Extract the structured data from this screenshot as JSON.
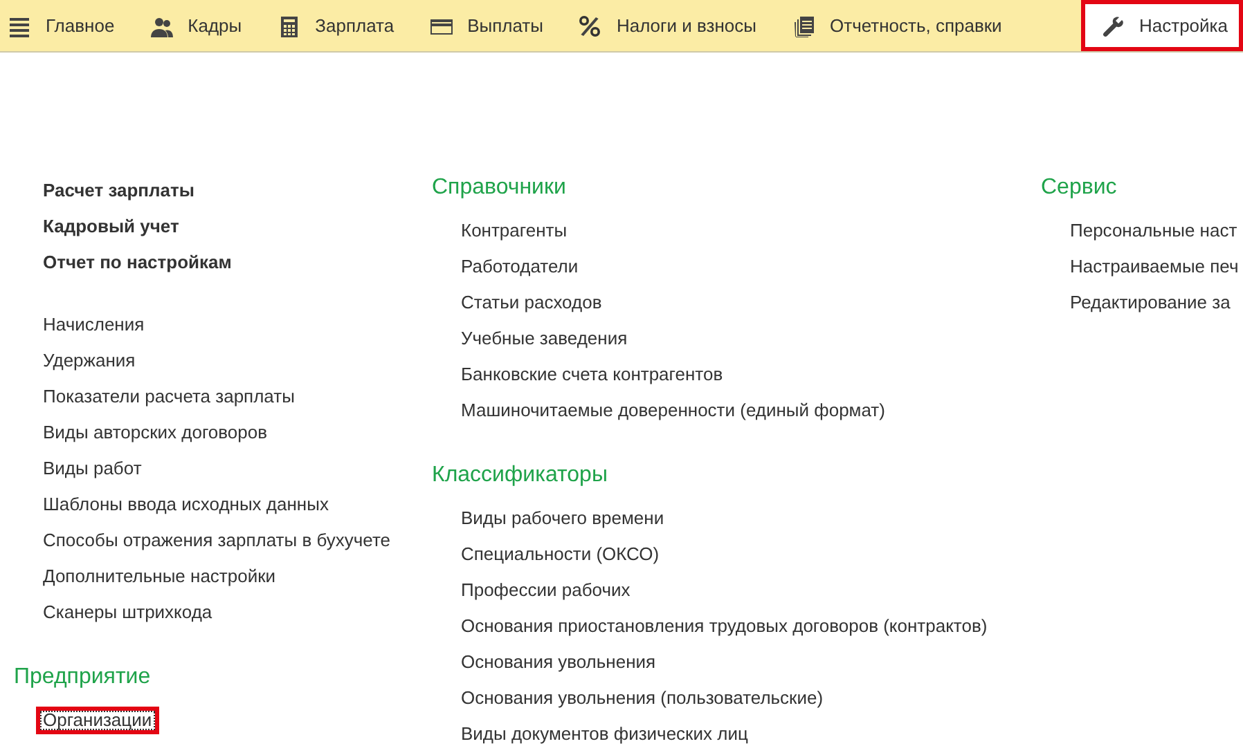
{
  "tabs": [
    {
      "label": "Главное",
      "kind": "menu",
      "selected": false
    },
    {
      "label": "Кадры",
      "kind": "people",
      "selected": false
    },
    {
      "label": "Зарплата",
      "kind": "calculator",
      "selected": false
    },
    {
      "label": "Выплаты",
      "kind": "card",
      "selected": false
    },
    {
      "label": "Налоги и взносы",
      "kind": "percent",
      "selected": false
    },
    {
      "label": "Отчетность, справки",
      "kind": "documents",
      "selected": false
    },
    {
      "label": "Настройка",
      "kind": "wrench",
      "selected": true
    }
  ],
  "columns": [
    {
      "sections": [
        {
          "items": [
            {
              "label": "Расчет зарплаты",
              "bold": true,
              "highlighted": false
            },
            {
              "label": "Кадровый учет",
              "bold": true,
              "highlighted": false
            },
            {
              "label": "Отчет по настройкам",
              "bold": true,
              "highlighted": false
            }
          ]
        },
        {
          "items": [
            {
              "label": "Начисления",
              "bold": false,
              "highlighted": false
            },
            {
              "label": "Удержания",
              "bold": false,
              "highlighted": false
            },
            {
              "label": "Показатели расчета зарплаты",
              "bold": false,
              "highlighted": false
            },
            {
              "label": "Виды авторских договоров",
              "bold": false,
              "highlighted": false
            },
            {
              "label": "Виды работ",
              "bold": false,
              "highlighted": false
            },
            {
              "label": "Шаблоны ввода исходных данных",
              "bold": false,
              "highlighted": false
            },
            {
              "label": "Способы отражения зарплаты в бухучете",
              "bold": false,
              "highlighted": false
            },
            {
              "label": "Дополнительные настройки",
              "bold": false,
              "highlighted": false
            },
            {
              "label": "Сканеры штрихкода",
              "bold": false,
              "highlighted": false
            }
          ]
        },
        {
          "title": "Предприятие",
          "items": [
            {
              "label": "Организации",
              "bold": false,
              "highlighted": true
            }
          ]
        }
      ]
    },
    {
      "sections": [
        {
          "title": "Справочники",
          "items": [
            {
              "label": "Контрагенты",
              "bold": false,
              "highlighted": false
            },
            {
              "label": "Работодатели",
              "bold": false,
              "highlighted": false
            },
            {
              "label": "Статьи расходов",
              "bold": false,
              "highlighted": false
            },
            {
              "label": "Учебные заведения",
              "bold": false,
              "highlighted": false
            },
            {
              "label": "Банковские счета контрагентов",
              "bold": false,
              "highlighted": false
            },
            {
              "label": "Машиночитаемые доверенности (единый формат)",
              "bold": false,
              "highlighted": false
            }
          ]
        },
        {
          "title": "Классификаторы",
          "items": [
            {
              "label": "Виды рабочего времени",
              "bold": false,
              "highlighted": false
            },
            {
              "label": "Специальности (ОКСО)",
              "bold": false,
              "highlighted": false
            },
            {
              "label": "Профессии рабочих",
              "bold": false,
              "highlighted": false
            },
            {
              "label": "Основания приостановления трудовых договоров (контрактов)",
              "bold": false,
              "highlighted": false
            },
            {
              "label": "Основания увольнения",
              "bold": false,
              "highlighted": false
            },
            {
              "label": "Основания увольнения (пользовательские)",
              "bold": false,
              "highlighted": false
            },
            {
              "label": "Виды документов физических лиц",
              "bold": false,
              "highlighted": false
            }
          ]
        }
      ]
    },
    {
      "sections": [
        {
          "title": "Сервис",
          "items": [
            {
              "label": "Персональные наст",
              "bold": false,
              "highlighted": false
            },
            {
              "label": "Настраиваемые печ",
              "bold": false,
              "highlighted": false
            },
            {
              "label": "Редактирование за",
              "bold": false,
              "highlighted": false
            }
          ]
        }
      ]
    }
  ]
}
